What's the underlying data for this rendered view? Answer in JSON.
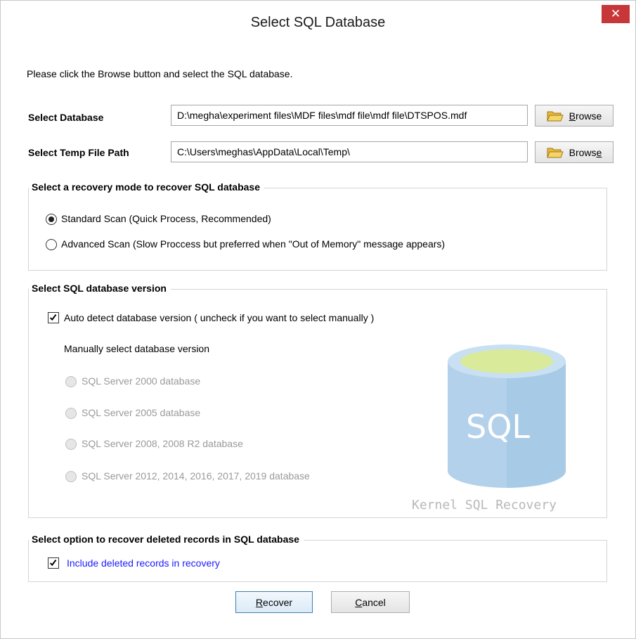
{
  "window": {
    "title": "Select SQL Database",
    "close_label": "✕"
  },
  "instruction": "Please click the Browse button and select the SQL database.",
  "database": {
    "label": "Select Database",
    "value": "D:\\megha\\experiment files\\MDF files\\mdf file\\mdf file\\DTSPOS.mdf",
    "browse_label_pre": "",
    "browse_label_underlined": "B",
    "browse_label_post": "rowse"
  },
  "temp": {
    "label": "Select Temp File Path",
    "value": "C:\\Users\\meghas\\AppData\\Local\\Temp\\",
    "browse_label_pre": "Brows",
    "browse_label_underlined": "e",
    "browse_label_post": ""
  },
  "recovery_mode": {
    "legend": "Select a recovery mode to recover SQL database",
    "options": [
      {
        "label": "Standard Scan (Quick Process, Recommended)",
        "selected": true
      },
      {
        "label": "Advanced Scan (Slow Proccess but preferred when \"Out of Memory\" message appears)",
        "selected": false
      }
    ]
  },
  "version": {
    "legend": "Select SQL database version",
    "auto_detect_label": "Auto detect database version ( uncheck if you want to select manually )",
    "auto_detect_checked": true,
    "manual_label": "Manually select database version",
    "options": [
      {
        "label": "SQL Server 2000 database"
      },
      {
        "label": "SQL Server 2005 database"
      },
      {
        "label": "SQL Server 2008, 2008 R2 database"
      },
      {
        "label": "SQL Server 2012, 2014, 2016, 2017, 2019 database"
      }
    ],
    "logo_text": "SQL",
    "watermark": "Kernel SQL Recovery"
  },
  "deleted": {
    "legend": "Select option to recover deleted records in SQL database",
    "include_label": "Include deleted records in recovery",
    "include_checked": true
  },
  "buttons": {
    "recover_underlined": "R",
    "recover_rest": "ecover",
    "cancel_underlined": "C",
    "cancel_rest": "ancel"
  },
  "colors": {
    "close_bg": "#c7373a",
    "link_blue": "#1a1aff",
    "cylinder_blue": "#b3d1ea",
    "cylinder_top": "#d9ea9a"
  }
}
